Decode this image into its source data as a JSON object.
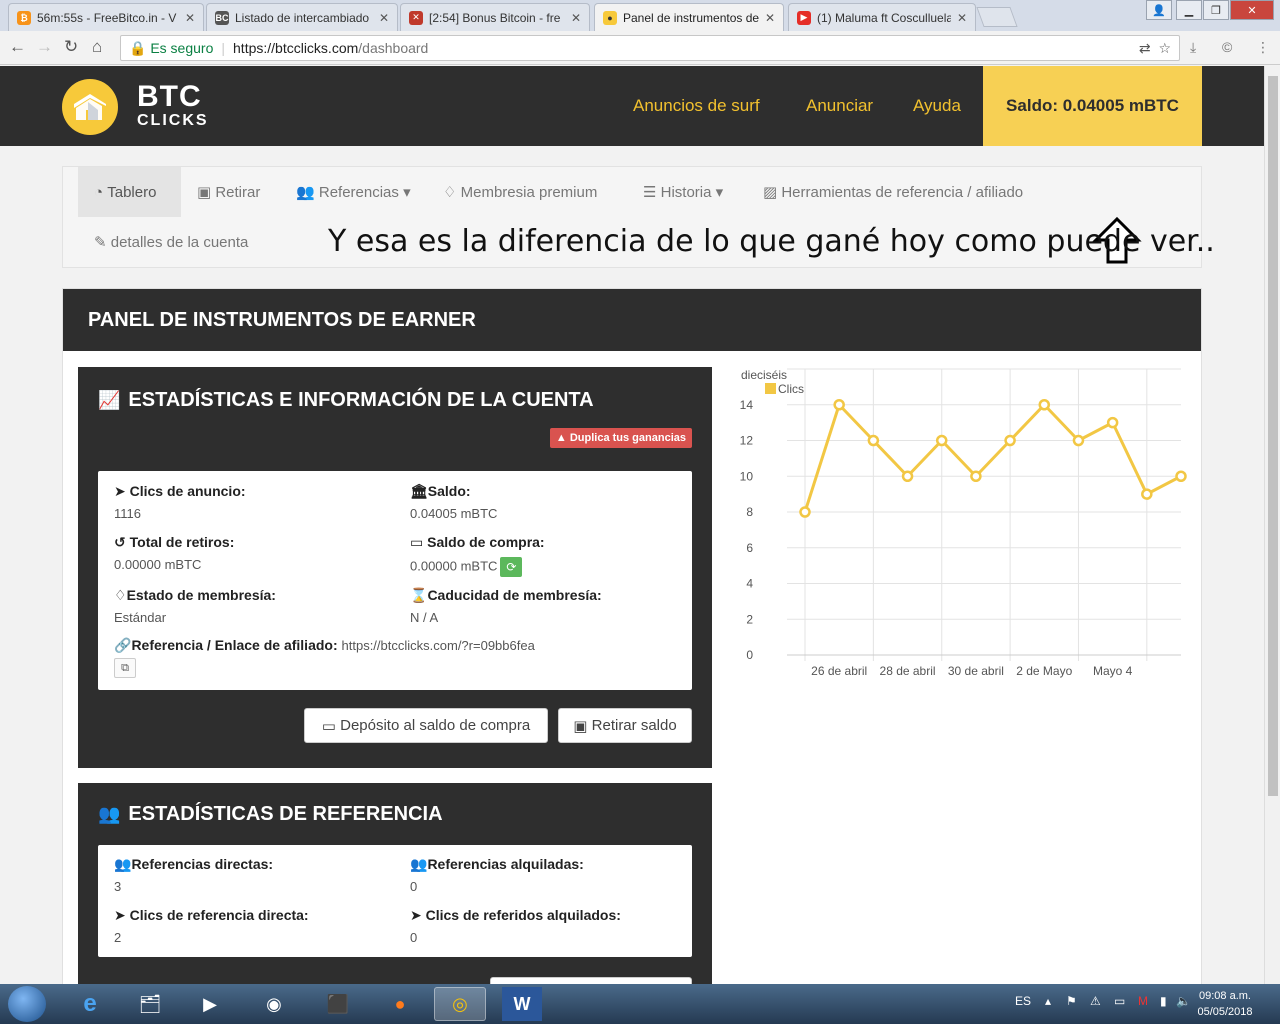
{
  "browser": {
    "tabs": [
      {
        "title": "56m:55s - FreeBitco.in - V",
        "icon": "bitcoin-favicon",
        "color": "#f7931a"
      },
      {
        "title": "Listado de intercambiado",
        "icon": "bc-favicon",
        "color": "#555555"
      },
      {
        "title": "[2:54] Bonus Bitcoin - fre",
        "icon": "bonus-favicon",
        "color": "#c0392b"
      },
      {
        "title": "Panel de instrumentos de",
        "icon": "btcclicks-favicon",
        "color": "#f7c93a"
      },
      {
        "title": "(1) Maluma ft Cosculluela",
        "icon": "youtube-favicon",
        "color": "#e52d27"
      }
    ],
    "secure_label": "Es seguro",
    "url_host": "https://btcclicks.com",
    "url_path": "/dashboard"
  },
  "site": {
    "logo_line1": "BTC",
    "logo_line2": "CLICKS",
    "nav": [
      "Anuncios de surf",
      "Anunciar",
      "Ayuda"
    ],
    "balance": "Saldo: 0.04005 mBTC",
    "brand_color": "#f7c93a"
  },
  "subnav": {
    "items": [
      {
        "label": "Tablero",
        "icon": "dashboard-icon"
      },
      {
        "label": "Retirar",
        "icon": "money-icon"
      },
      {
        "label": "Referencias",
        "icon": "users-icon"
      },
      {
        "label": "Membresia premium",
        "icon": "diamond-icon"
      },
      {
        "label": "Historia",
        "icon": "list-icon"
      },
      {
        "label": "Herramientas de referencia / afiliado",
        "icon": "image-icon"
      },
      {
        "label": "detalles de la cuenta",
        "icon": "edit-icon"
      }
    ]
  },
  "annotation": "Y esa es la diferencia de lo que gané hoy como puede ver..",
  "panel_title": "PANEL DE INSTRUMENTOS DE EARNER",
  "account": {
    "title": "ESTADÍSTICAS E INFORMACIÓN DE LA CUENTA",
    "badge": "Duplica tus ganancias",
    "stats": {
      "ad_clicks_label": "Clics de anuncio:",
      "ad_clicks_value": "1116",
      "balance_label": "Saldo:",
      "balance_value": "0.04005 mBTC",
      "withdrawals_label": "Total de retiros:",
      "withdrawals_value": "0.00000 mBTC",
      "purchase_label": "Saldo de compra:",
      "purchase_value": "0.00000 mBTC",
      "membership_label": "Estado de membresía:",
      "membership_value": "Estándar",
      "expiry_label": "Caducidad de membresía:",
      "expiry_value": "N / A",
      "ref_label": "Referencia / Enlace de afiliado:",
      "ref_value": "https://btcclicks.com/?r=09bb6fea"
    },
    "buttons": {
      "deposit": "Depósito al saldo de compra",
      "withdraw": "Retirar saldo"
    }
  },
  "referrals": {
    "title": "ESTADÍSTICAS DE REFERENCIA",
    "direct_label": "Referencias directas:",
    "direct_value": "3",
    "rented_label": "Referencias alquiladas:",
    "rented_value": "0",
    "direct_clicks_label": "Clics de referencia directa:",
    "direct_clicks_value": "2",
    "rented_clicks_label": "Clics de referidos alquilados:",
    "rented_clicks_value": "0"
  },
  "chart_data": {
    "type": "line",
    "top_label": "dieciséis",
    "series": [
      {
        "name": "Clics",
        "color": "#f2c744",
        "values": [
          8,
          14,
          12,
          10,
          12,
          10,
          12,
          14,
          12,
          13,
          9,
          10
        ]
      }
    ],
    "x_tick_labels": [
      "26 de abril",
      "28 de abril",
      "30 de abril",
      "2 de Mayo",
      "Mayo 4"
    ],
    "y_ticks": [
      0,
      2,
      4,
      6,
      8,
      10,
      12,
      14
    ],
    "ylim": [
      0,
      16
    ],
    "grid": true,
    "legend": "top-left"
  },
  "taskbar": {
    "lang": "ES",
    "time": "09:08 a.m.",
    "date": "05/05/2018"
  }
}
